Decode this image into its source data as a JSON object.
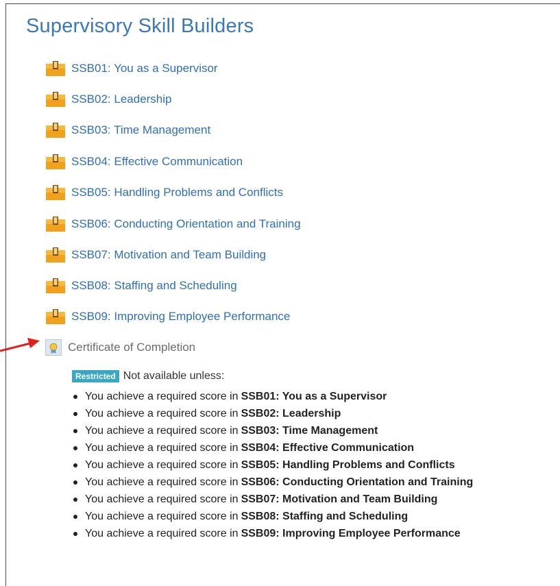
{
  "section": {
    "title": "Supervisory Skill Builders"
  },
  "activities": [
    {
      "label": "SSB01: You as a Supervisor"
    },
    {
      "label": "SSB02: Leadership"
    },
    {
      "label": "SSB03: Time Management"
    },
    {
      "label": "SSB04: Effective Communication"
    },
    {
      "label": "SSB05: Handling Problems and Conflicts"
    },
    {
      "label": "SSB06: Conducting Orientation and Training"
    },
    {
      "label": "SSB07: Motivation and Team Building"
    },
    {
      "label": "SSB08: Staffing and Scheduling"
    },
    {
      "label": "SSB09: Improving Employee Performance"
    }
  ],
  "certificate": {
    "label": "Certificate of Completion",
    "badge": "Restricted",
    "restriction_text": "Not available unless:",
    "condition_prefix": "You achieve a required score in",
    "conditions": [
      "SSB01: You as a Supervisor",
      "SSB02: Leadership",
      "SSB03: Time Management",
      "SSB04: Effective Communication",
      "SSB05: Handling Problems and Conflicts",
      "SSB06: Conducting Orientation and Training",
      "SSB07: Motivation and Team Building",
      "SSB08: Staffing and Scheduling",
      "SSB09: Improving Employee Performance"
    ]
  },
  "colors": {
    "link": "#2f6fb5",
    "title": "#3b78b7",
    "badge": "#3aa8c4",
    "arrow": "#e0201b",
    "package_icon": "#f5a623"
  },
  "icons": {
    "activity": "package-icon",
    "certificate": "certificate-icon",
    "annotation": "red-arrow-icon"
  }
}
